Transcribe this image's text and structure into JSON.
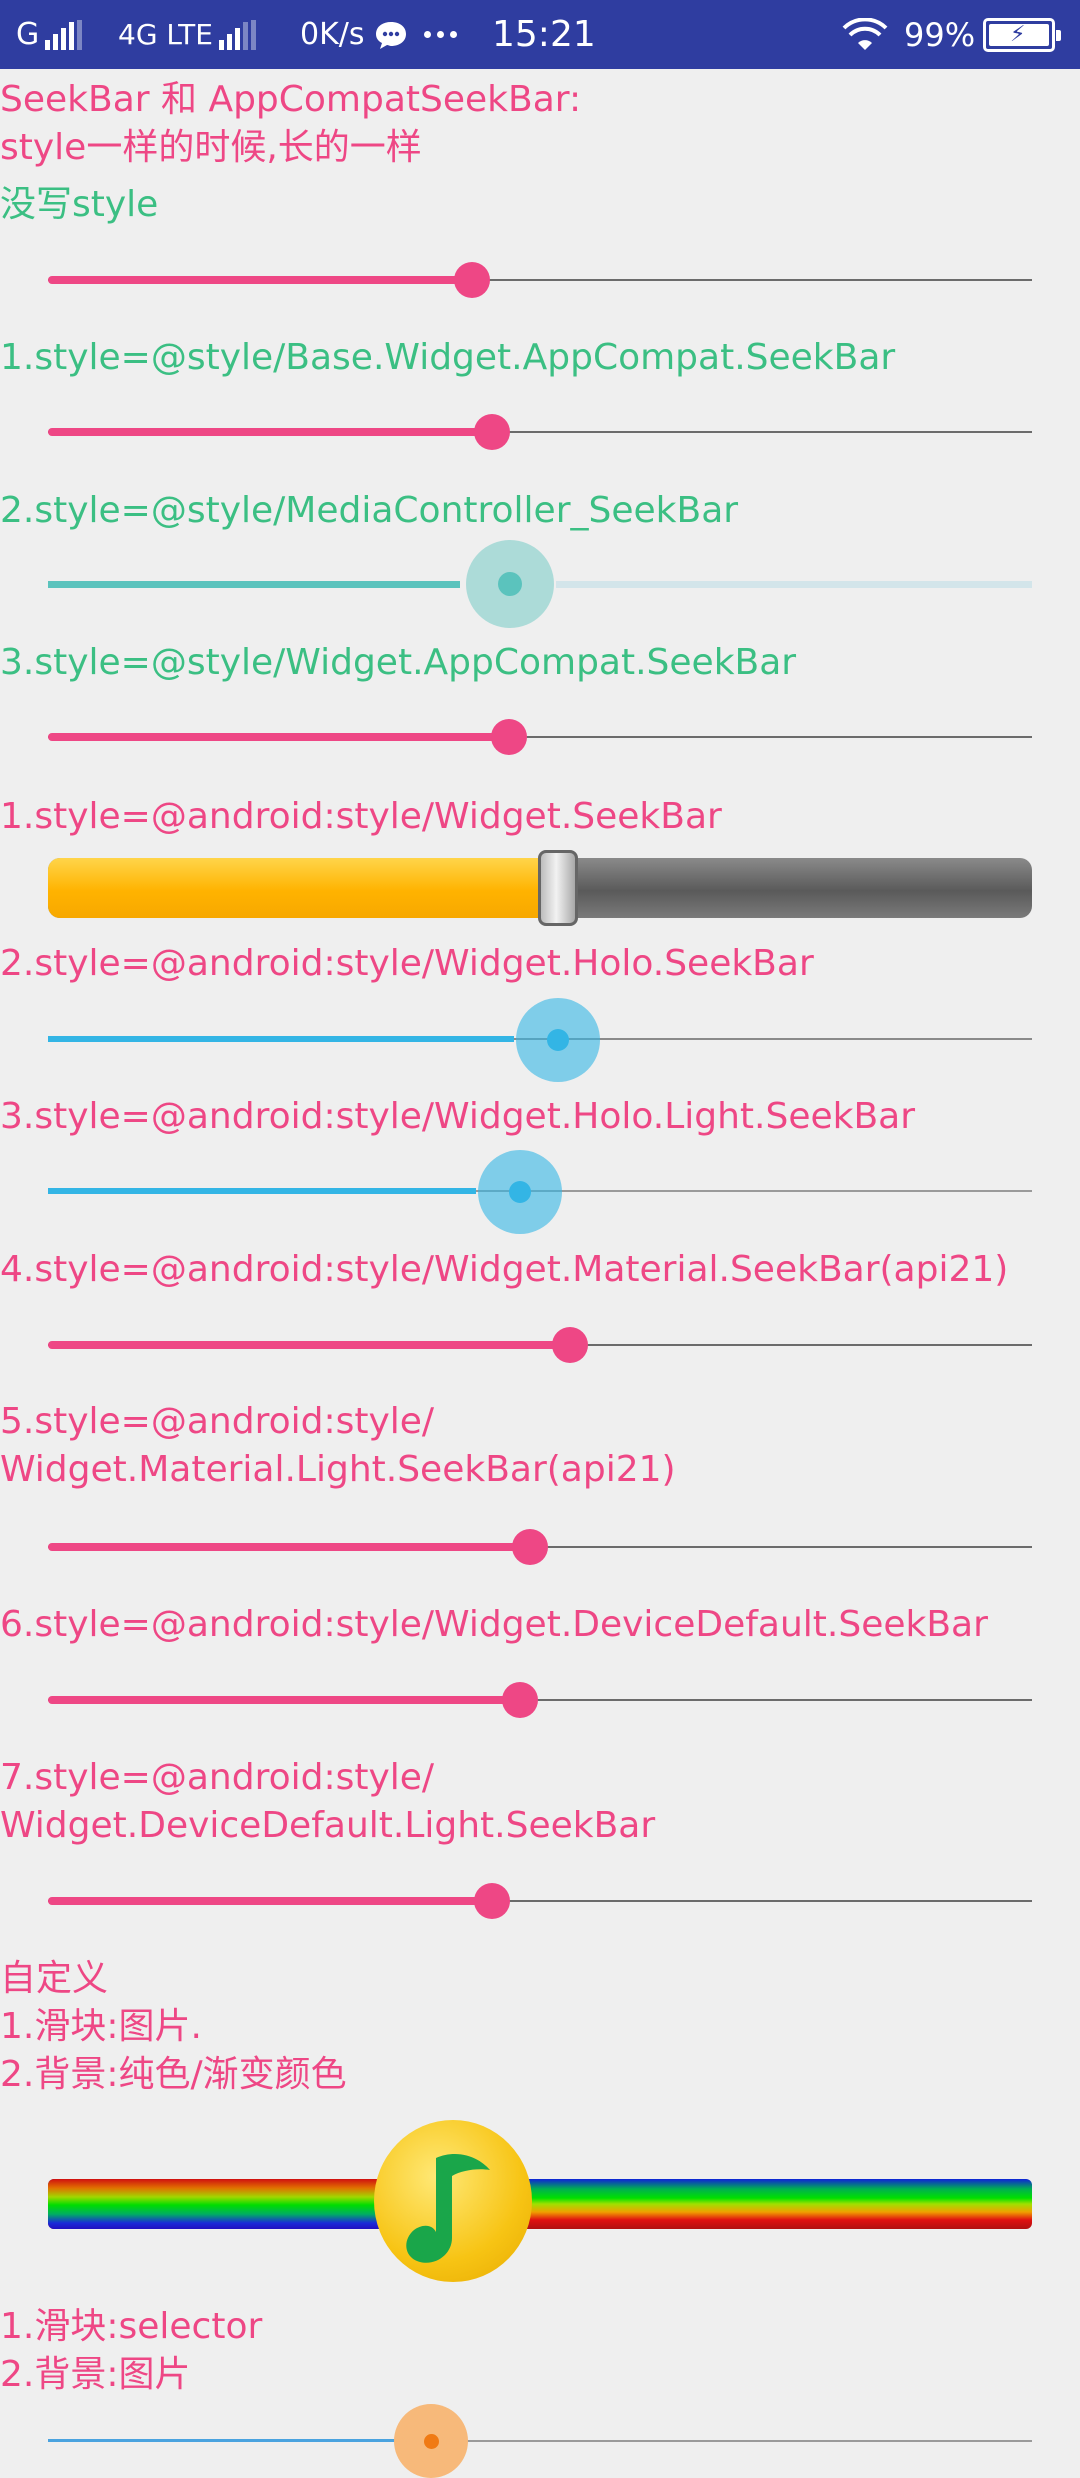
{
  "status_bar": {
    "carrier": "G",
    "network": "4G LTE",
    "speed": "0K/s",
    "time": "15:21",
    "battery": "99%",
    "background": "#2f3da0"
  },
  "colors": {
    "accent_pink": "#ee4785",
    "label_green": "#3bbf83",
    "holo_blue": "#33b5e5",
    "media_teal": "#5bc3bd",
    "background": "#efefef"
  },
  "header": {
    "line1": "SeekBar 和 AppCompatSeekBar:",
    "line2": "style一样的时候,长的一样"
  },
  "labels": {
    "no_style": "没写style",
    "appcompat_1": "1.style=@style/Base.Widget.AppCompat.SeekBar",
    "appcompat_2": "2.style=@style/MediaController_SeekBar",
    "appcompat_3": "3.style=@style/Widget.AppCompat.SeekBar",
    "android_1": "1.style=@android:style/Widget.SeekBar",
    "android_2": "2.style=@android:style/Widget.Holo.SeekBar",
    "android_3": "3.style=@android:style/Widget.Holo.Light.SeekBar",
    "android_4": "4.style=@android:style/Widget.Material.SeekBar(api21)",
    "android_5_line1": "5.style=@android:style/",
    "android_5_line2": "Widget.Material.Light.SeekBar(api21)",
    "android_6": "6.style=@android:style/Widget.DeviceDefault.SeekBar",
    "android_7_line1": "7.style=@android:style/",
    "android_7_line2": "Widget.DeviceDefault.Light.SeekBar",
    "custom_title": "自定义",
    "custom_1": "1.滑块:图片.",
    "custom_2": "2.背景:纯色/渐变颜色",
    "selector_1": "1.滑块:selector",
    "selector_2": "2.背景:图片"
  },
  "seekbars": {
    "no_style_progress": 0.43,
    "base_appcompat_progress": 0.45,
    "media_controller_progress": 0.47,
    "widget_appcompat_progress": 0.47,
    "android_widget_progress": 0.52,
    "holo_progress": 0.52,
    "holo_light_progress": 0.48,
    "material_progress": 0.53,
    "material_light_progress": 0.49,
    "device_default_progress": 0.48,
    "device_default_light_progress": 0.45,
    "custom_image_progress": 0.41,
    "selector_progress": 0.39
  },
  "icons": {
    "custom_thumb": "music-note-icon"
  }
}
